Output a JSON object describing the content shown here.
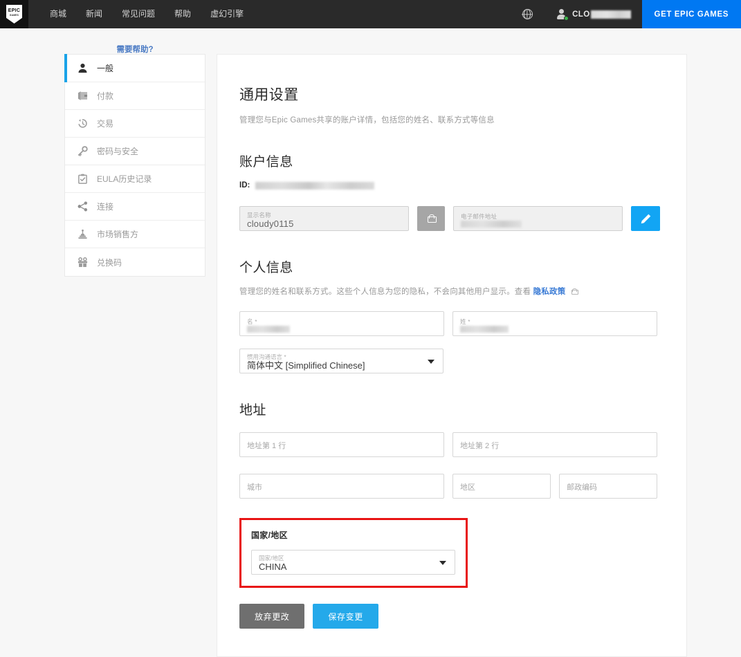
{
  "topbar": {
    "logo": {
      "line1": "EPIC",
      "line2": "GAMES"
    },
    "nav_items": [
      {
        "label": "商城",
        "name": "nav-store"
      },
      {
        "label": "新闻",
        "name": "nav-news"
      },
      {
        "label": "常见问题",
        "name": "nav-faq"
      },
      {
        "label": "帮助",
        "name": "nav-help"
      },
      {
        "label": "虚幻引擎",
        "name": "nav-unreal-engine"
      }
    ],
    "language_icon": "globe-icon",
    "user": {
      "name_visible": "CLO",
      "name_redacted": true,
      "status": "online"
    },
    "cta_label": "GET EPIC GAMES",
    "cta_color": "#0078f2",
    "background_color": "#2a2a2a"
  },
  "sidebar": {
    "items": [
      {
        "label": "一般",
        "icon": "person-icon",
        "active": true
      },
      {
        "label": "付款",
        "icon": "wallet-icon",
        "active": false
      },
      {
        "label": "交易",
        "icon": "history-clock-icon",
        "active": false
      },
      {
        "label": "密码与安全",
        "icon": "key-icon",
        "active": false
      },
      {
        "label": "EULA历史记录",
        "icon": "clipboard-check-icon",
        "active": false
      },
      {
        "label": "连接",
        "icon": "share-icon",
        "active": false
      },
      {
        "label": "市场销售方",
        "icon": "gavel-icon",
        "active": false
      },
      {
        "label": "兑换码",
        "icon": "gift-icon",
        "active": false
      }
    ],
    "help_link": "需要帮助?",
    "active_accent_color": "#1aa3e8"
  },
  "main": {
    "page_title": "通用设置",
    "page_description": "管理您与Epic Games共享的账户详情，包括您的姓名、联系方式等信息",
    "account_section": {
      "title": "账户信息",
      "id_label": "ID:",
      "id_value_redacted": true,
      "display_name": {
        "label": "显示名称",
        "value": "cloudy0115",
        "locked": true
      },
      "lock_button_icon": "lock-icon",
      "email": {
        "label": "电子邮件地址",
        "value_redacted": true
      },
      "edit_button_icon": "pencil-icon"
    },
    "personal_section": {
      "title": "个人信息",
      "description": "管理您的姓名和联系方式。这些个人信息为您的隐私，不会向其他用户显示。查看",
      "privacy_link": "隐私政策",
      "privacy_lock_icon": "lock-icon",
      "first_name": {
        "label": "名 *",
        "value_redacted": true
      },
      "last_name": {
        "label": "姓 *",
        "value_redacted": true
      },
      "language": {
        "label": "惯用沟通语言 *",
        "value": "简体中文 [Simplified Chinese]"
      }
    },
    "address_section": {
      "title": "地址",
      "address_line_1": {
        "placeholder": "地址第 1 行",
        "value": ""
      },
      "address_line_2": {
        "placeholder": "地址第 2 行",
        "value": ""
      },
      "city": {
        "placeholder": "城市",
        "value": ""
      },
      "state": {
        "placeholder": "地区",
        "value": ""
      },
      "postal_code": {
        "placeholder": "邮政编码",
        "value": ""
      }
    },
    "country_section": {
      "title": "国家/地区",
      "country": {
        "label": "国家/地区",
        "value": "CHINA"
      },
      "highlight_color": "#e81414"
    },
    "actions": {
      "discard_label": "放弃更改",
      "save_label": "保存变更",
      "discard_color": "#6f6f6f",
      "save_color": "#24a9ea"
    }
  }
}
